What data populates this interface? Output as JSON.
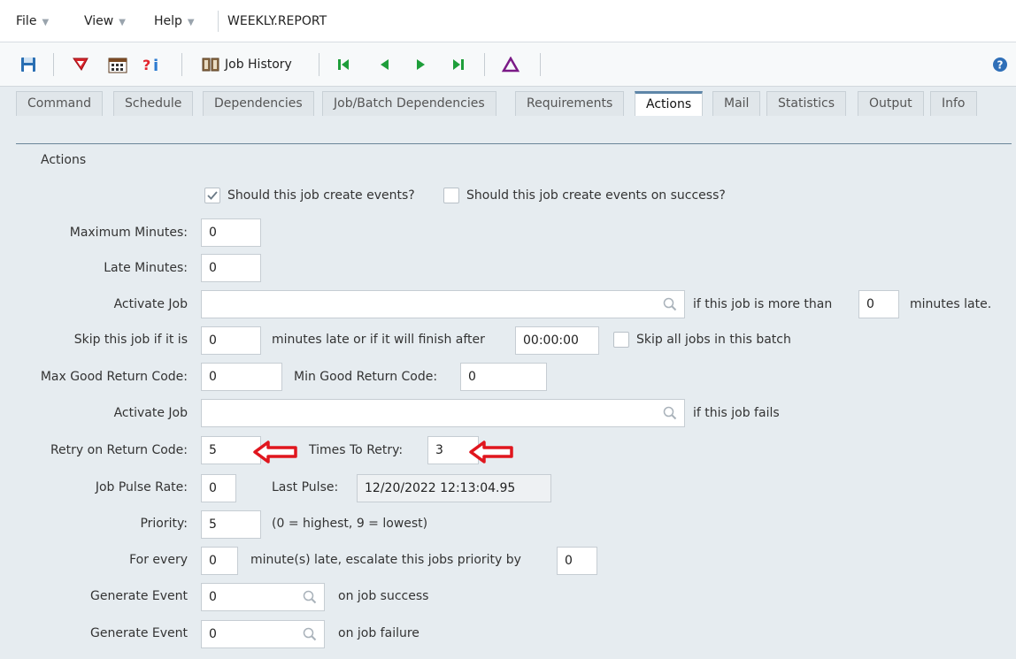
{
  "menubar": {
    "file": "File",
    "view": "View",
    "help": "Help",
    "title": "WEEKLY.REPORT"
  },
  "toolbar": {
    "job_history": "Job History"
  },
  "tabs": [
    {
      "label": "Command"
    },
    {
      "label": "Schedule"
    },
    {
      "label": "Dependencies"
    },
    {
      "label": "Job/Batch Dependencies"
    },
    {
      "label": "Requirements"
    },
    {
      "label": "Actions"
    },
    {
      "label": "Mail"
    },
    {
      "label": "Statistics"
    },
    {
      "label": "Output"
    },
    {
      "label": "Info"
    }
  ],
  "form": {
    "section_title": "Actions",
    "create_events_label": "Should this job create events?",
    "create_events_checked": true,
    "create_events_success_label": "Should this job create events on success?",
    "max_minutes_label": "Maximum Minutes:",
    "max_minutes": "0",
    "late_minutes_label": "Late Minutes:",
    "late_minutes": "0",
    "activate_job_label": "Activate Job",
    "activate_job_late": "",
    "if_more_than": "if this job is more than",
    "late_threshold": "0",
    "minutes_late": "minutes late.",
    "skip_label": "Skip this job if it is",
    "skip_minutes": "0",
    "skip_text": "minutes late or if it will finish after",
    "skip_time": "00:00:00",
    "skip_all_label": "Skip all jobs in this batch",
    "max_good_label": "Max Good Return Code:",
    "max_good": "0",
    "min_good_label": "Min Good Return Code:",
    "min_good": "0",
    "activate_job_fail_label": "Activate Job",
    "activate_job_fail": "",
    "if_fails": "if this job fails",
    "retry_rc_label": "Retry on Return Code:",
    "retry_rc": "5",
    "times_retry_label": "Times To Retry:",
    "times_retry": "3",
    "pulse_rate_label": "Job Pulse Rate:",
    "pulse_rate": "0",
    "last_pulse_label": "Last Pulse:",
    "last_pulse": "12/20/2022 12:13:04.95",
    "priority_label": "Priority:",
    "priority": "5",
    "priority_hint": "(0 = highest, 9 = lowest)",
    "for_every_label": "For every",
    "for_every": "0",
    "escalate_text": "minute(s) late, escalate this jobs priority by",
    "escalate_by": "0",
    "gen_event_label": "Generate Event",
    "gen_event_success": "0",
    "on_success": "on job success",
    "gen_event_failure": "0",
    "on_failure": "on job failure"
  },
  "colors": {
    "accent": "#5e86a8",
    "arrow_red": "#e0161e",
    "background": "#e6ecf0"
  }
}
